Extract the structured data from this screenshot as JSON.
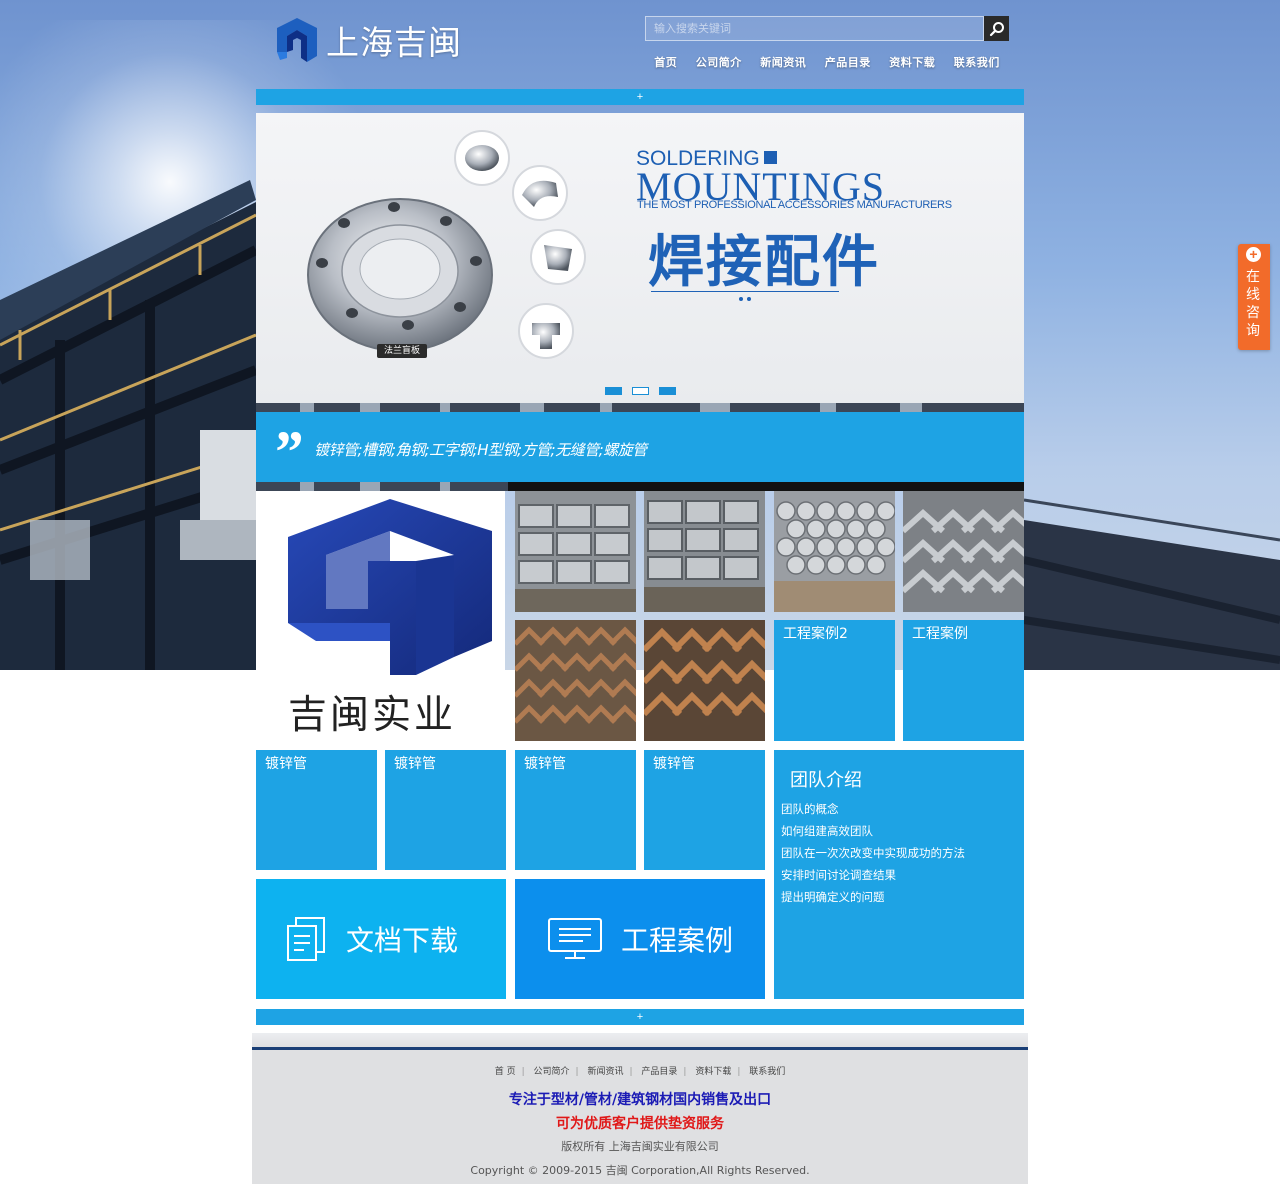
{
  "header": {
    "logo_text": "上海吉闽",
    "search_placeholder": "输入搜索关键词",
    "nav": [
      "首页",
      "公司简介",
      "新闻资讯",
      "产品目录",
      "资料下载",
      "联系我们"
    ]
  },
  "bars": {
    "top_symbol": "+",
    "bottom_symbol": "+"
  },
  "banner": {
    "title_en_small": "SOLDERING",
    "title_en_big": "MOUNTINGS",
    "subtitle_en": "THE MOST PROFESSIONAL ACCESSORIES MANUFACTURERS",
    "title_cn": "焊接配件",
    "product_tag": "法兰盲板",
    "active_slide": 2,
    "slide_count": 3
  },
  "quote": {
    "mark": "”",
    "text": "镀锌管;槽钢;角钢;工字钢;H型钢;方管;无缝管;螺旋管"
  },
  "brand": {
    "name": "吉闽实业"
  },
  "case_tiles": [
    "工程案例2",
    "工程案例"
  ],
  "product_tiles": [
    "镀锌管",
    "镀锌管",
    "镀锌管",
    "镀锌管"
  ],
  "big_tiles": {
    "download": "文档下载",
    "cases": "工程案例"
  },
  "team": {
    "title": "团队介绍",
    "items": [
      "团队的概念",
      "如何组建高效团队",
      "团队在一次次改变中实现成功的方法",
      "安排时间讨论调查结果",
      "提出明确定义的问题"
    ]
  },
  "footer": {
    "nav": [
      "首 页",
      "公司简介",
      "新闻资讯",
      "产品目录",
      "资料下载",
      "联系我们"
    ],
    "line1": "专注于型材/管材/建筑钢材国内销售及出口",
    "line2": "可为优质客户提供垫资服务",
    "line3": "版权所有 上海吉闽实业有限公司",
    "line4": "Copyright © 2009-2015 吉闽 Corporation,All Rights Reserved."
  },
  "consult": {
    "plus": "+",
    "text": "在线咨询"
  },
  "colors": {
    "accent_blue": "#1ea3e4",
    "cases_tile_blue": "#0c8fed",
    "download_tile_blue": "#0db2f0",
    "brand_navy": "#1b3f9c",
    "consult_orange": "#f26b2a",
    "footer_highlight_blue": "#1b1bb5",
    "footer_highlight_red": "#e01818"
  }
}
